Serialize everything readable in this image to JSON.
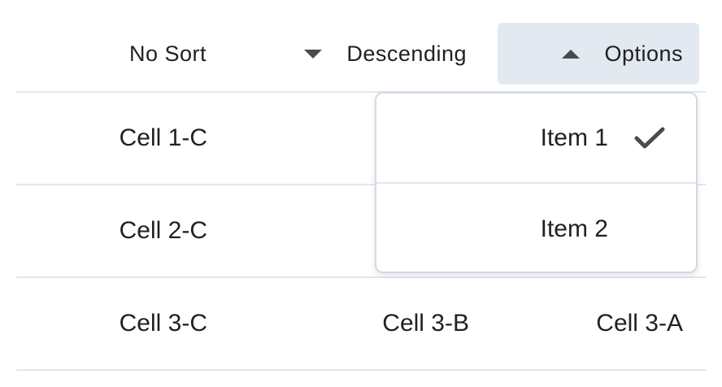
{
  "table": {
    "headers": {
      "col_c": "No Sort",
      "col_b": "Descending",
      "col_a": "Options"
    },
    "rows": [
      {
        "c": "Cell 1-C",
        "b": "",
        "a": ""
      },
      {
        "c": "Cell 2-C",
        "b": "",
        "a": ""
      },
      {
        "c": "Cell 3-C",
        "b": "Cell 3-B",
        "a": "Cell 3-A"
      }
    ]
  },
  "dropdown": {
    "items": [
      {
        "label": "Item 1",
        "selected": true
      },
      {
        "label": "Item 2",
        "selected": false
      }
    ]
  },
  "icons": {
    "descending_caret": "caret-down-icon",
    "options_caret": "caret-up-icon",
    "selected_check": "checkmark-icon"
  },
  "colors": {
    "active_header_bg": "#e3e9f1",
    "divider": "#e3e5f0",
    "text": "#202122",
    "icon": "#494c4e"
  }
}
